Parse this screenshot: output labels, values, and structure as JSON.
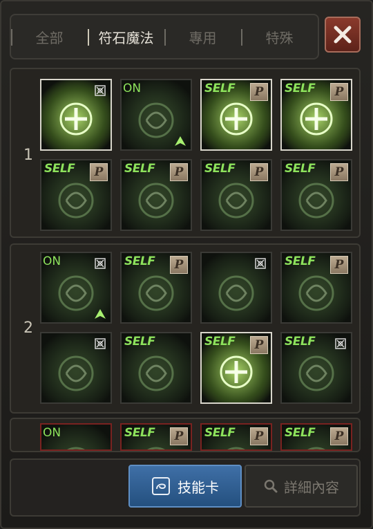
{
  "tabs": [
    {
      "label": "全部",
      "active": false
    },
    {
      "label": "符石魔法",
      "active": true
    },
    {
      "label": "專用",
      "active": false
    },
    {
      "label": "特殊",
      "active": false
    }
  ],
  "close_icon": "close-x-icon",
  "sections": [
    {
      "number": "1",
      "skills": [
        {
          "icon": "green-burst-icon",
          "tag": "",
          "badge": "lock",
          "up": false,
          "highlight": true
        },
        {
          "icon": "sword-slash-icon",
          "tag": "ON",
          "badge": "",
          "up": true,
          "highlight": false
        },
        {
          "icon": "green-demon-fist-icon",
          "tag": "SELF",
          "badge": "P",
          "up": false,
          "highlight": true
        },
        {
          "icon": "holy-cross-circle-icon",
          "tag": "SELF",
          "badge": "P",
          "up": false,
          "highlight": true
        },
        {
          "icon": "shield-swirl-icon",
          "tag": "SELF",
          "badge": "P",
          "up": false,
          "highlight": false
        },
        {
          "icon": "double-chevron-icon",
          "tag": "SELF",
          "badge": "P",
          "up": false,
          "highlight": false
        },
        {
          "icon": "heartbeat-icon",
          "tag": "SELF",
          "badge": "P",
          "up": false,
          "highlight": false
        },
        {
          "icon": "armor-figure-icon",
          "tag": "SELF",
          "badge": "P",
          "up": false,
          "highlight": false
        }
      ]
    },
    {
      "number": "2",
      "skills": [
        {
          "icon": "dash-figure-icon",
          "tag": "ON",
          "badge": "lock",
          "up": true,
          "highlight": false
        },
        {
          "icon": "sword-circle-icon",
          "tag": "SELF",
          "badge": "P",
          "up": false,
          "highlight": false
        },
        {
          "icon": "eye-icon",
          "tag": "",
          "badge": "lock",
          "up": false,
          "highlight": false
        },
        {
          "icon": "tent-icon",
          "tag": "SELF",
          "badge": "P",
          "up": false,
          "highlight": false
        },
        {
          "icon": "star-swirl-icon",
          "tag": "",
          "badge": "lock",
          "up": false,
          "highlight": false
        },
        {
          "icon": "person-silhouette-icon",
          "tag": "SELF",
          "badge": "",
          "up": false,
          "highlight": false
        },
        {
          "icon": "glowing-person-icon",
          "tag": "SELF",
          "badge": "P",
          "up": false,
          "highlight": true
        },
        {
          "icon": "chameleon-icon",
          "tag": "SELF",
          "badge": "lock",
          "up": false,
          "highlight": false
        }
      ]
    },
    {
      "number": "",
      "skills": [
        {
          "icon": "blade-icon",
          "tag": "ON",
          "badge": "",
          "up": false,
          "highlight": false
        },
        {
          "icon": "orb-icon",
          "tag": "SELF",
          "badge": "P",
          "up": false,
          "highlight": false
        },
        {
          "icon": "rune-icon",
          "tag": "SELF",
          "badge": "P",
          "up": false,
          "highlight": false
        },
        {
          "icon": "rune-circle-icon",
          "tag": "SELF",
          "badge": "P",
          "up": false,
          "highlight": false
        }
      ]
    }
  ],
  "buttons": {
    "skill_card_label": "技能卡",
    "skill_card_icon": "skill-card-icon",
    "details_label": "詳細內容",
    "details_icon": "magnifier-icon"
  },
  "colors": {
    "green_text": "#8de25c",
    "primary_button": "#3f6fa6",
    "close_button": "#8a3a2c"
  }
}
